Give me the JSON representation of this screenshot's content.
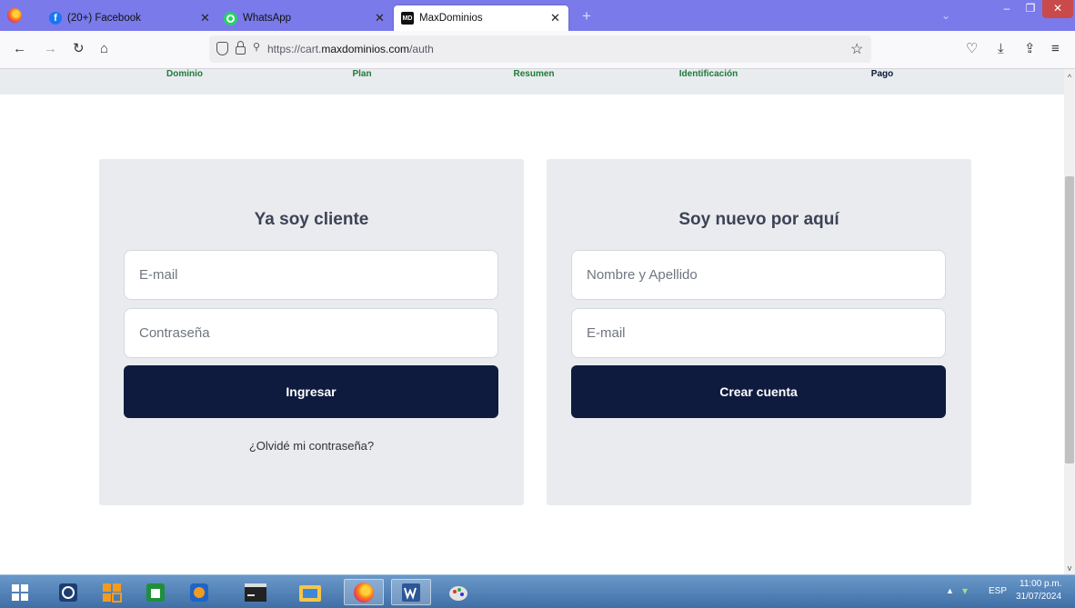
{
  "browser": {
    "tabs": [
      {
        "label": "(20+) Facebook",
        "icon": "facebook-icon"
      },
      {
        "label": "WhatsApp",
        "icon": "whatsapp-icon"
      },
      {
        "label": "MaxDominios",
        "icon": "maxdominios-icon",
        "active": true
      }
    ],
    "url_prefix": "https://cart.",
    "url_domain": "maxdominios.com",
    "url_path": "/auth"
  },
  "steps": [
    "Dominio",
    "Plan",
    "Resumen",
    "Identificación",
    "Pago"
  ],
  "login": {
    "title": "Ya soy cliente",
    "email_placeholder": "E-mail",
    "password_placeholder": "Contraseña",
    "submit_label": "Ingresar",
    "forgot_label": "¿Olvidé mi contraseña?"
  },
  "register": {
    "title": "Soy nuevo por aquí",
    "name_placeholder": "Nombre y Apellido",
    "email_placeholder": "E-mail",
    "submit_label": "Crear cuenta"
  },
  "taskbar": {
    "language": "ESP",
    "time": "11:00 p.m.",
    "date": "31/07/2024"
  },
  "colors": {
    "primary_button": "#0e1b3f",
    "card_background": "#e9ebee",
    "tabbar": "#7a7aeb"
  }
}
